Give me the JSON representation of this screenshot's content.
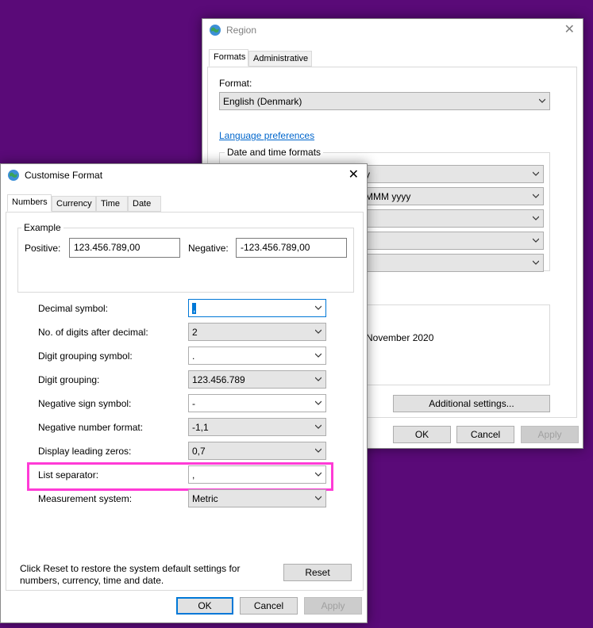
{
  "region_window": {
    "title": "Region",
    "tabs": [
      "Formats",
      "Administrative"
    ],
    "format_label": "Format:",
    "format_value": "English (Denmark)",
    "language_link": "Language preferences",
    "date_time_group": "Date and time formats",
    "short_date_partial": "y",
    "long_date_partial": "MMM yyyy",
    "example_partial": "November 2020",
    "additional_settings": "Additional settings...",
    "ok": "OK",
    "cancel": "Cancel",
    "apply": "Apply"
  },
  "customise_window": {
    "title": "Customise Format",
    "tabs": [
      "Numbers",
      "Currency",
      "Time",
      "Date"
    ],
    "example_group": "Example",
    "positive_label": "Positive:",
    "positive_value": "123.456.789,00",
    "negative_label": "Negative:",
    "negative_value": "-123.456.789,00",
    "rows": [
      {
        "label": "Decimal symbol:",
        "value": ","
      },
      {
        "label": "No. of digits after decimal:",
        "value": "2"
      },
      {
        "label": "Digit grouping symbol:",
        "value": "."
      },
      {
        "label": "Digit grouping:",
        "value": "123.456.789"
      },
      {
        "label": "Negative sign symbol:",
        "value": "-"
      },
      {
        "label": "Negative number format:",
        "value": "-1,1"
      },
      {
        "label": "Display leading zeros:",
        "value": "0,7"
      },
      {
        "label": "List separator:",
        "value": ","
      },
      {
        "label": "Measurement system:",
        "value": "Metric"
      }
    ],
    "reset_note": "Click Reset to restore the system default settings for numbers, currency, time and date.",
    "reset": "Reset",
    "ok": "OK",
    "cancel": "Cancel",
    "apply": "Apply"
  },
  "colors": {
    "desktop": "#5a0a78",
    "highlight": "#ff3bd6",
    "accent": "#0078d7"
  }
}
